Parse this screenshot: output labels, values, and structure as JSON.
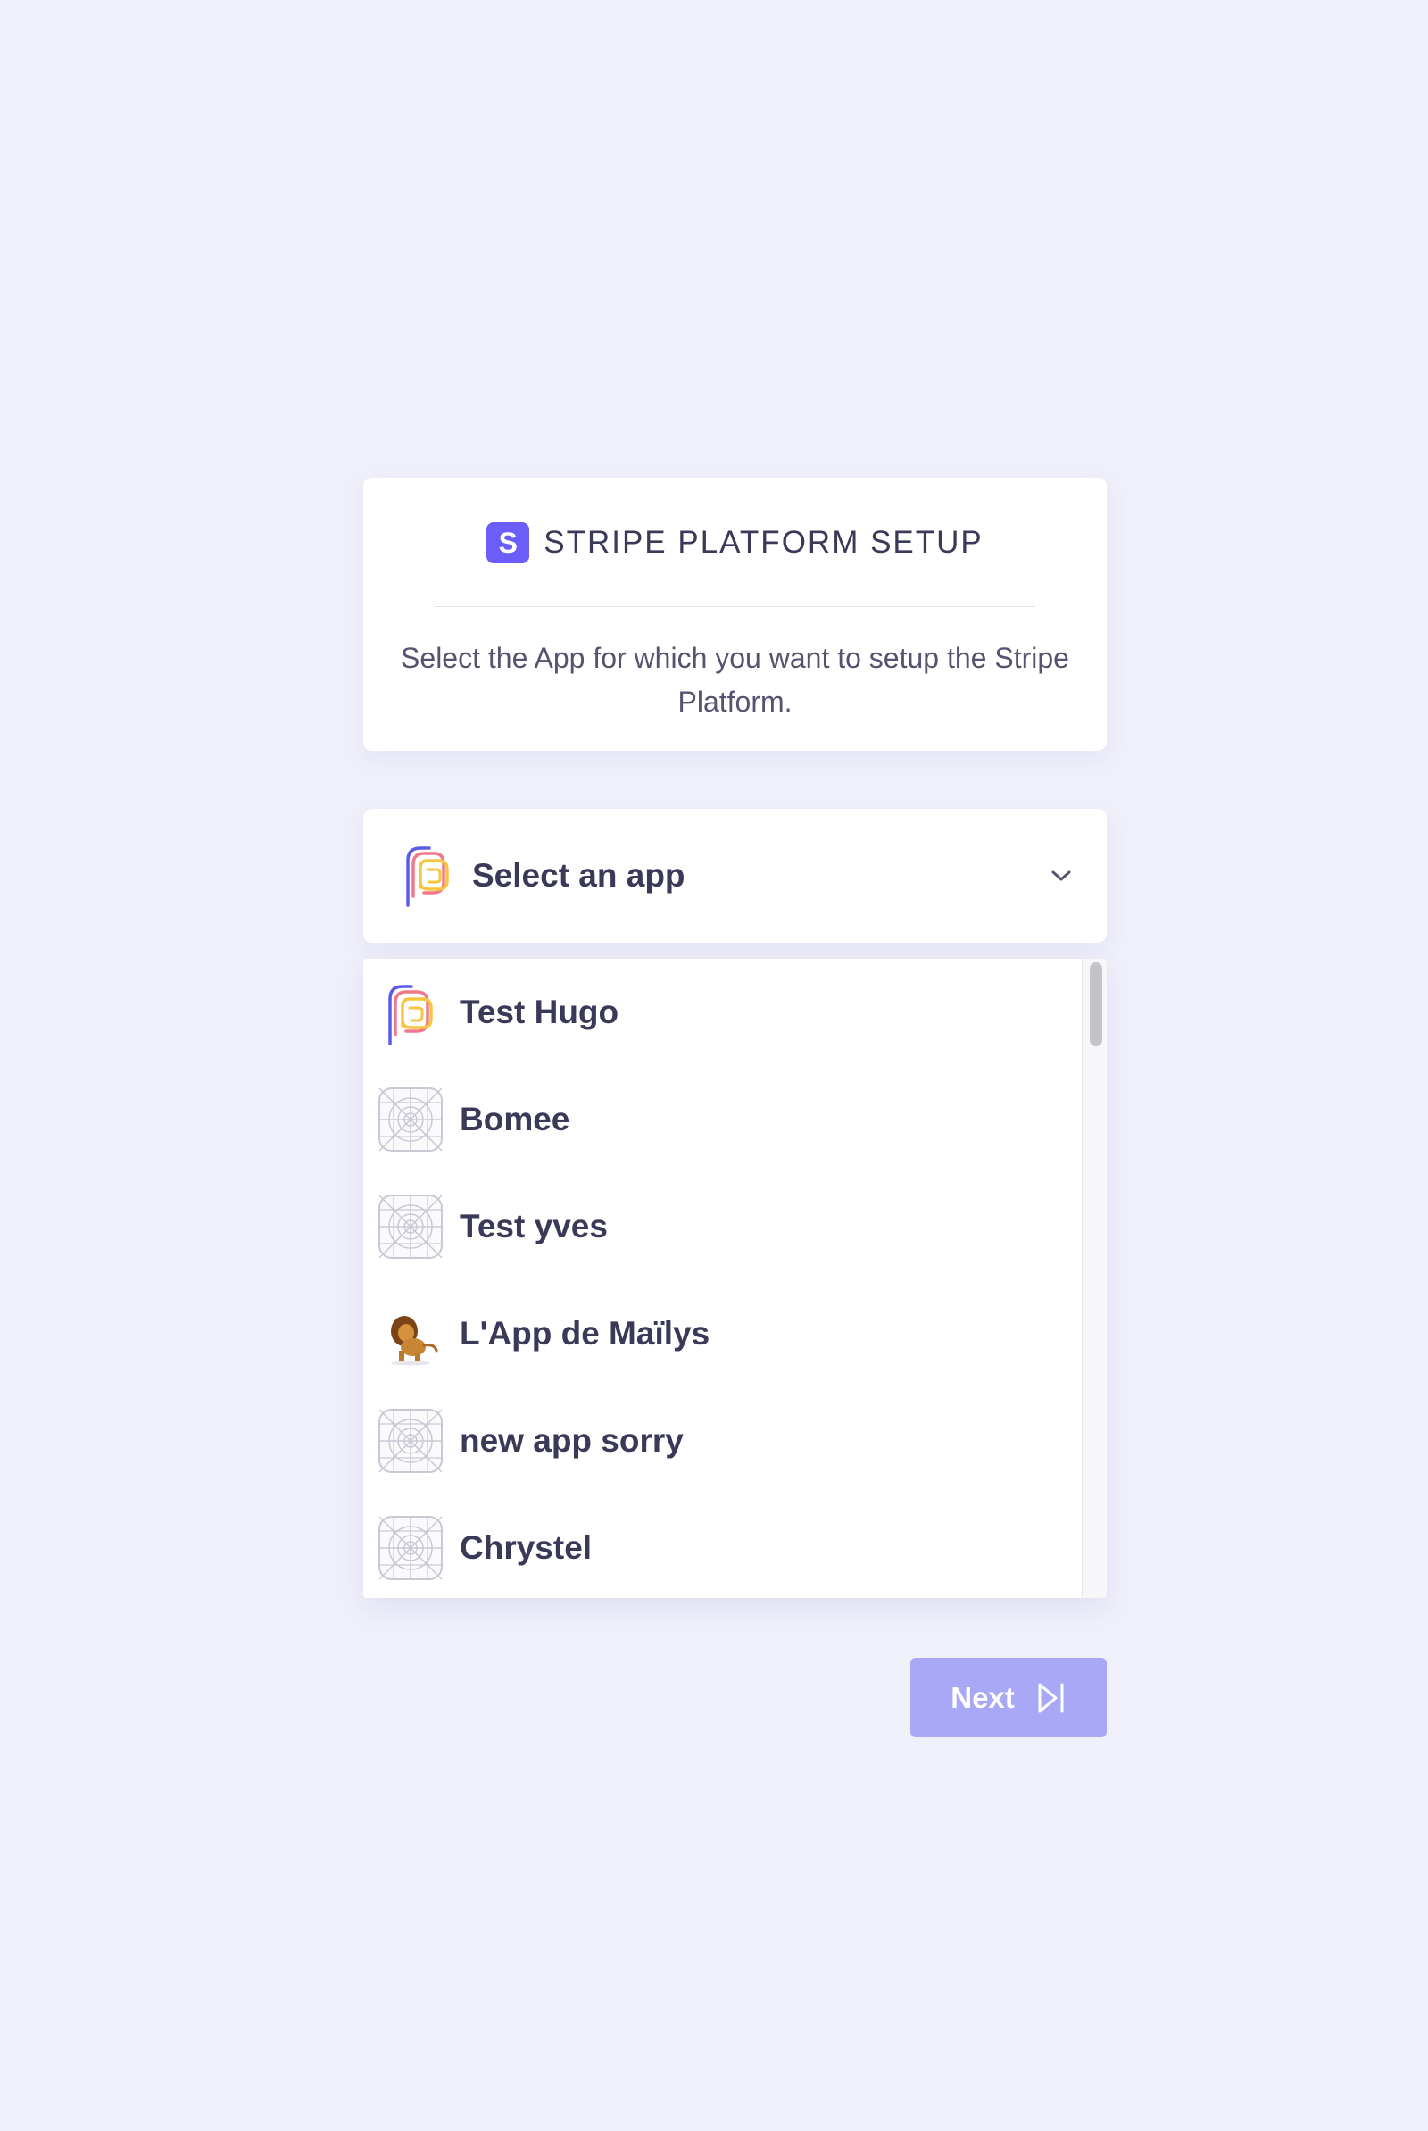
{
  "header": {
    "badge_letter": "S",
    "title": "STRIPE PLATFORM SETUP",
    "description": "Select the App for which you want to setup the Stripe Platform."
  },
  "select": {
    "placeholder": "Select an app",
    "icon": "app-logo-icon",
    "toggle_icon": "chevron-down-icon"
  },
  "apps": [
    {
      "label": "Test Hugo",
      "icon": "app-logo-icon"
    },
    {
      "label": "Bomee",
      "icon": "placeholder-grid-icon"
    },
    {
      "label": "Test yves",
      "icon": "placeholder-grid-icon"
    },
    {
      "label": "L'App de Maïlys",
      "icon": "lion-avatar-icon"
    },
    {
      "label": "new app sorry",
      "icon": "placeholder-grid-icon"
    },
    {
      "label": "Chrystel",
      "icon": "placeholder-grid-icon"
    }
  ],
  "footer": {
    "next_label": "Next",
    "next_icon": "skip-next-icon"
  },
  "colors": {
    "background": "#f0f0fa",
    "accent": "#6b5ef8",
    "button_disabled": "#a8a8f6",
    "text": "#3a3a58"
  }
}
